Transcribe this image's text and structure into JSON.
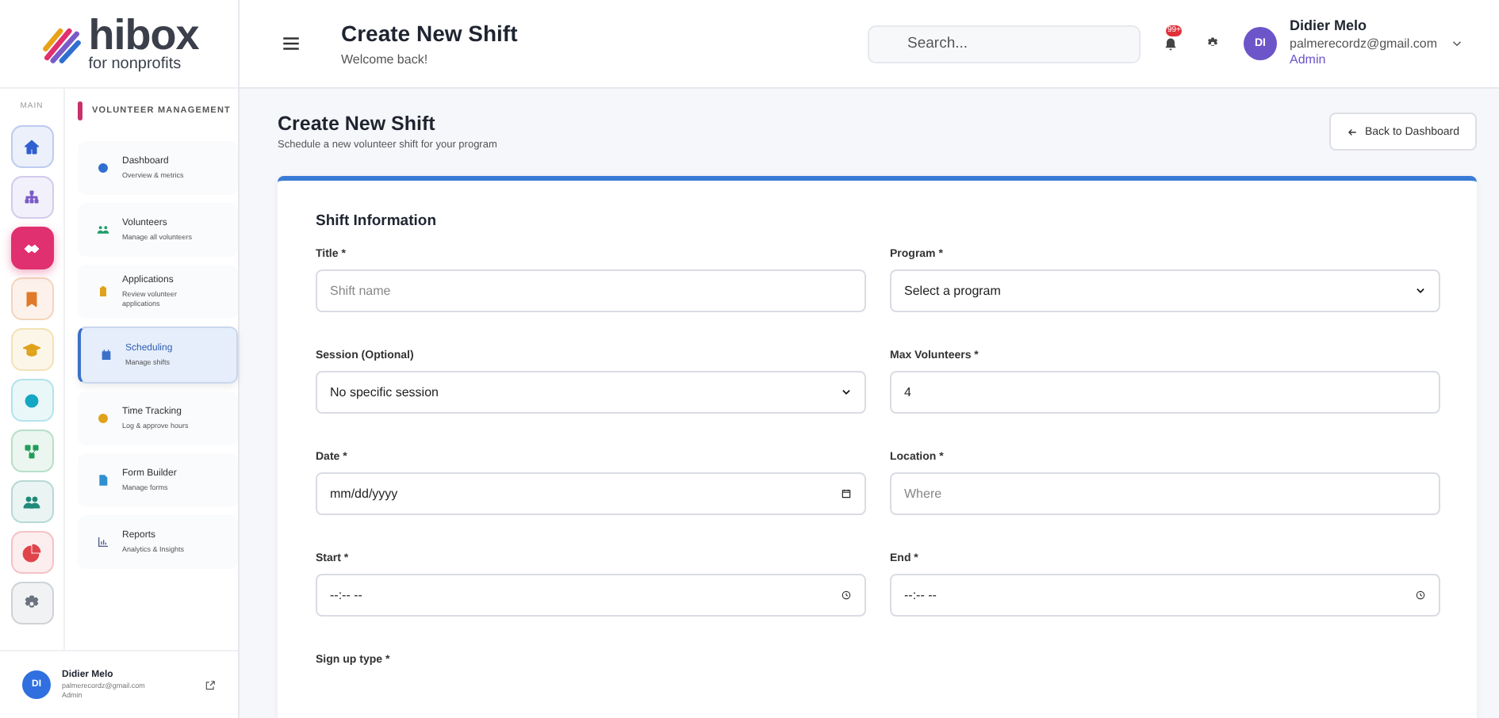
{
  "logo": {
    "name": "hibox",
    "tagline": "for nonprofits"
  },
  "rail": {
    "label": "MAIN",
    "items": [
      {
        "color": "#2f5fd0",
        "selected": false
      },
      {
        "color": "#7a5bc7",
        "selected": false
      },
      {
        "color": "#e0306f",
        "selected": true
      },
      {
        "color": "#e07a2a",
        "selected": false
      },
      {
        "color": "#e0a21a",
        "selected": false
      },
      {
        "color": "#14a7c4",
        "selected": false
      },
      {
        "color": "#1f9d5a",
        "selected": false
      },
      {
        "color": "#1f8a7a",
        "selected": false
      },
      {
        "color": "#e0434a",
        "selected": false
      },
      {
        "color": "#6b7280",
        "selected": false
      }
    ]
  },
  "nav": {
    "section": "VOLUNTEER MANAGEMENT",
    "items": [
      {
        "title": "Dashboard",
        "subtitle": "Overview & metrics",
        "color": "#2f6fd0",
        "selected": false
      },
      {
        "title": "Volunteers",
        "subtitle": "Manage all volunteers",
        "color": "#1f9d6a",
        "selected": false
      },
      {
        "title": "Applications",
        "subtitle": "Review volunteer applications",
        "color": "#e0a21a",
        "selected": false
      },
      {
        "title": "Scheduling",
        "subtitle": "Manage shifts",
        "color": "#3b6fc8",
        "selected": true
      },
      {
        "title": "Time Tracking",
        "subtitle": "Log & approve hours",
        "color": "#e0a21a",
        "selected": false
      },
      {
        "title": "Form Builder",
        "subtitle": "Manage forms",
        "color": "#2f8fd0",
        "selected": false
      },
      {
        "title": "Reports",
        "subtitle": "Analytics & Insights",
        "color": "#4b5a8a",
        "selected": false
      }
    ]
  },
  "sidebar_user": {
    "initials": "DI",
    "name": "Didier Melo",
    "email": "palmerecordz@gmail.com",
    "role": "Admin"
  },
  "header": {
    "title": "Create New Shift",
    "subtitle": "Welcome back!",
    "search": {
      "placeholder": "Search..."
    },
    "notification_badge": "99+",
    "user": {
      "initials": "DI",
      "name": "Didier Melo",
      "email": "palmerecordz@gmail.com",
      "role": "Admin"
    }
  },
  "page": {
    "title": "Create New Shift",
    "subtitle": "Schedule a new volunteer shift for your program",
    "back_button": "Back to Dashboard"
  },
  "form": {
    "section": "Shift Information",
    "fields": [
      {
        "label": "Title *",
        "kind": "text",
        "placeholder": "Shift name"
      },
      {
        "label": "Program *",
        "kind": "select",
        "value": "Select a program"
      },
      {
        "label": "Session (Optional)",
        "kind": "select",
        "value": "No specific session"
      },
      {
        "label": "Max Volunteers *",
        "kind": "text",
        "value": "4"
      },
      {
        "label": "Date *",
        "kind": "date",
        "value": "mm/dd/yyyy"
      },
      {
        "label": "Location *",
        "kind": "text",
        "placeholder": "Where"
      },
      {
        "label": "Start *",
        "kind": "time",
        "value": "--:-- --"
      },
      {
        "label": "End *",
        "kind": "time",
        "value": "--:-- --"
      },
      {
        "label": "Sign up type *",
        "kind": "label"
      }
    ]
  }
}
